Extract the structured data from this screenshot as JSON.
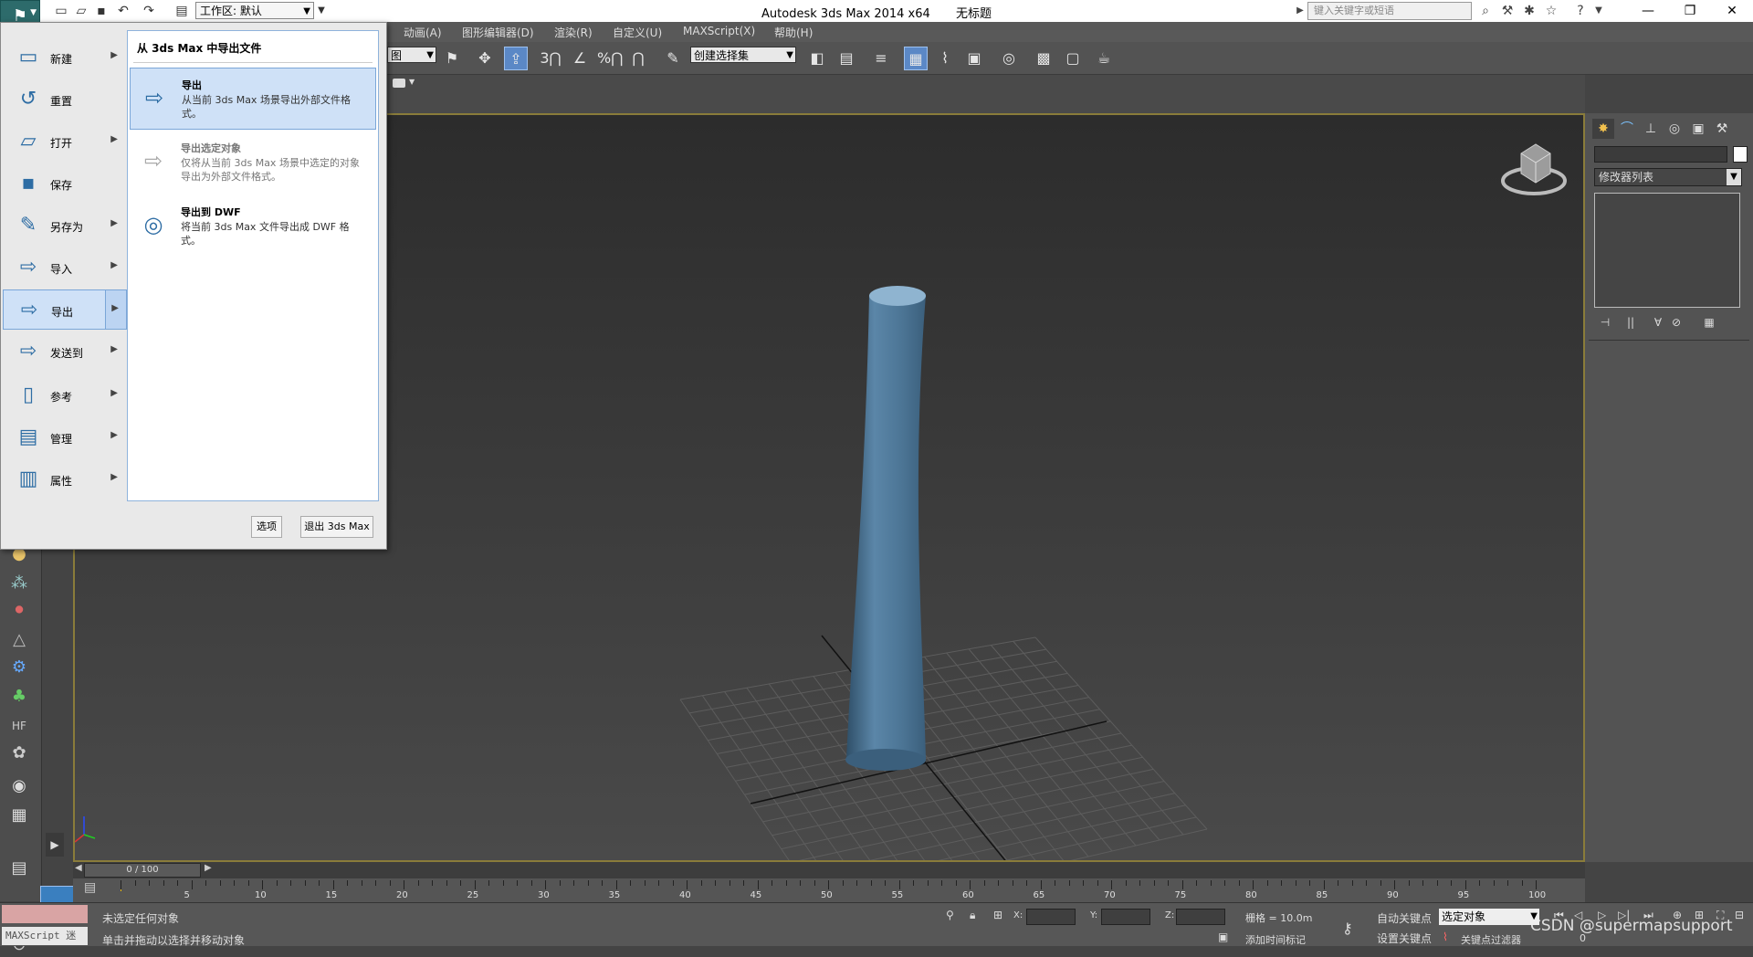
{
  "titlebar": {
    "app_title": "Autodesk 3ds Max  2014 x64",
    "doc_title": "无标题",
    "workspace_label": "工作区: 默认",
    "search_placeholder": "键入关键字或短语"
  },
  "menubar": {
    "items": [
      "动画(A)",
      "图形编辑器(D)",
      "渲染(R)",
      "自定义(U)",
      "MAXScript(X)",
      "帮助(H)"
    ]
  },
  "toolbar": {
    "view_combo": "图",
    "selection_set": "创建选择集",
    "snap_3": "3",
    "snap_percent": "%"
  },
  "app_menu": {
    "items": [
      {
        "label": "新建",
        "icon": "new-file-icon",
        "arrow": true
      },
      {
        "label": "重置",
        "icon": "reset-icon",
        "arrow": false
      },
      {
        "label": "打开",
        "icon": "open-folder-icon",
        "arrow": true
      },
      {
        "label": "保存",
        "icon": "save-icon",
        "arrow": false
      },
      {
        "label": "另存为",
        "icon": "save-as-icon",
        "arrow": true
      },
      {
        "label": "导入",
        "icon": "import-icon",
        "arrow": true
      },
      {
        "label": "导出",
        "icon": "export-icon",
        "arrow": true,
        "selected": true
      },
      {
        "label": "发送到",
        "icon": "send-to-icon",
        "arrow": true
      },
      {
        "label": "参考",
        "icon": "reference-icon",
        "arrow": true
      },
      {
        "label": "管理",
        "icon": "manage-icon",
        "arrow": true
      },
      {
        "label": "属性",
        "icon": "properties-icon",
        "arrow": true
      }
    ],
    "panel_title": "从 3ds Max 中导出文件",
    "sub_items": [
      {
        "title": "导出",
        "desc": "从当前 3ds Max 场景导出外部文件格式。"
      },
      {
        "title": "导出选定对象",
        "desc": "仅将从当前 3ds Max 场景中选定的对象导出为外部文件格式。"
      },
      {
        "title": "导出到 DWF",
        "desc": "将当前 3ds Max 文件导出成 DWF 格式。"
      }
    ],
    "options_button": "选项",
    "exit_button": "退出 3ds Max"
  },
  "command_panel": {
    "modifier_list": "修改器列表"
  },
  "timeline": {
    "frame_display": "0 / 100",
    "ticks": [
      "5",
      "10",
      "15",
      "20",
      "25",
      "30",
      "35",
      "40",
      "45",
      "50",
      "55",
      "60",
      "65",
      "70",
      "75",
      "80",
      "85",
      "90",
      "95",
      "100"
    ]
  },
  "status": {
    "line1": "未选定任何对象",
    "line2": "单击并拖动以选择并移动对象",
    "maxscript_label": "MAXScript 迷",
    "x_label": "X:",
    "y_label": "Y:",
    "z_label": "Z:",
    "grid": "栅格 = 10.0m",
    "auto_key": "自动关键点",
    "set_key": "设置关键点",
    "key_filter": "关键点过滤器",
    "add_time_tag": "添加时间标记",
    "selected_object": "选定对象",
    "frame_zero": "0"
  },
  "watermark": "CSDN @supermapsupport",
  "colors": {
    "viewport_border": "#8a7c3a",
    "cylinder": "#4f7898",
    "menu_highlight": "#cfe1f7",
    "app_button": "#2d6b6b"
  }
}
